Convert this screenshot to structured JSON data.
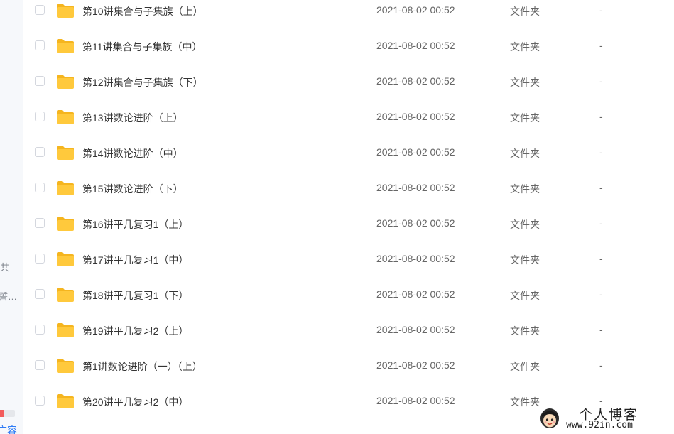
{
  "sidebar": {
    "fragment_1": "共",
    "fragment_2": "誓…",
    "link_fragment": "广容",
    "quota_fraction": 0.3
  },
  "colors": {
    "folder": "#FFC93C",
    "folder_tab": "#F5B51F",
    "quota": "#F25B5B",
    "link": "#2F7CF6"
  },
  "files": [
    {
      "name": "第10讲集合与子集族（上）",
      "date": "2021-08-02 00:52",
      "type": "文件夹",
      "size": "-"
    },
    {
      "name": "第11讲集合与子集族（中）",
      "date": "2021-08-02 00:52",
      "type": "文件夹",
      "size": "-"
    },
    {
      "name": "第12讲集合与子集族（下）",
      "date": "2021-08-02 00:52",
      "type": "文件夹",
      "size": "-"
    },
    {
      "name": "第13讲数论进阶（上）",
      "date": "2021-08-02 00:52",
      "type": "文件夹",
      "size": "-"
    },
    {
      "name": "第14讲数论进阶（中）",
      "date": "2021-08-02 00:52",
      "type": "文件夹",
      "size": "-"
    },
    {
      "name": "第15讲数论进阶（下）",
      "date": "2021-08-02 00:52",
      "type": "文件夹",
      "size": "-"
    },
    {
      "name": "第16讲平几复习1（上）",
      "date": "2021-08-02 00:52",
      "type": "文件夹",
      "size": "-"
    },
    {
      "name": "第17讲平几复习1（中）",
      "date": "2021-08-02 00:52",
      "type": "文件夹",
      "size": "-"
    },
    {
      "name": "第18讲平几复习1（下）",
      "date": "2021-08-02 00:52",
      "type": "文件夹",
      "size": "-"
    },
    {
      "name": "第19讲平几复习2（上）",
      "date": "2021-08-02 00:52",
      "type": "文件夹",
      "size": "-"
    },
    {
      "name": "第1讲数论进阶（一）（上）",
      "date": "2021-08-02 00:52",
      "type": "文件夹",
      "size": "-"
    },
    {
      "name": "第20讲平几复习2（中）",
      "date": "2021-08-02 00:52",
      "type": "文件夹",
      "size": "-"
    }
  ],
  "watermark": {
    "title": "个人博客",
    "url": "www.92in.com"
  }
}
